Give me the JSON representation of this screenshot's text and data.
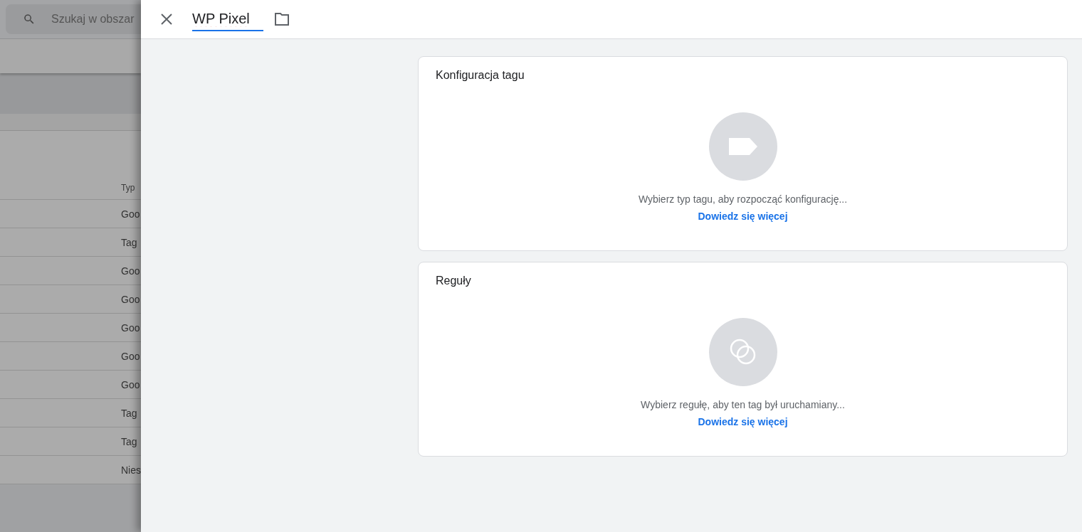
{
  "background_page": {
    "search": {
      "placeholder": "Szukaj w obszar"
    },
    "table": {
      "column_header": "Typ",
      "rows": [
        {
          "type": "Goo"
        },
        {
          "type": "Tag"
        },
        {
          "type": "Goo"
        },
        {
          "type": "Goo"
        },
        {
          "type": "Goo"
        },
        {
          "type": "Goo"
        },
        {
          "type": "Goo"
        },
        {
          "type": "Tag"
        },
        {
          "type": "Tag"
        },
        {
          "type": "Nies"
        }
      ]
    }
  },
  "panel": {
    "title_field": {
      "value": "WP Pixel"
    },
    "cards": [
      {
        "kind": "tag",
        "title": "Konfiguracja tagu",
        "hint": "Wybierz typ tagu, aby rozpocząć konfigurację...",
        "link": "Dowiedz się więcej"
      },
      {
        "kind": "trigger",
        "title": "Reguły",
        "hint": "Wybierz regułę, aby ten tag był uruchamiany...",
        "link": "Dowiedz się więcej"
      }
    ]
  }
}
